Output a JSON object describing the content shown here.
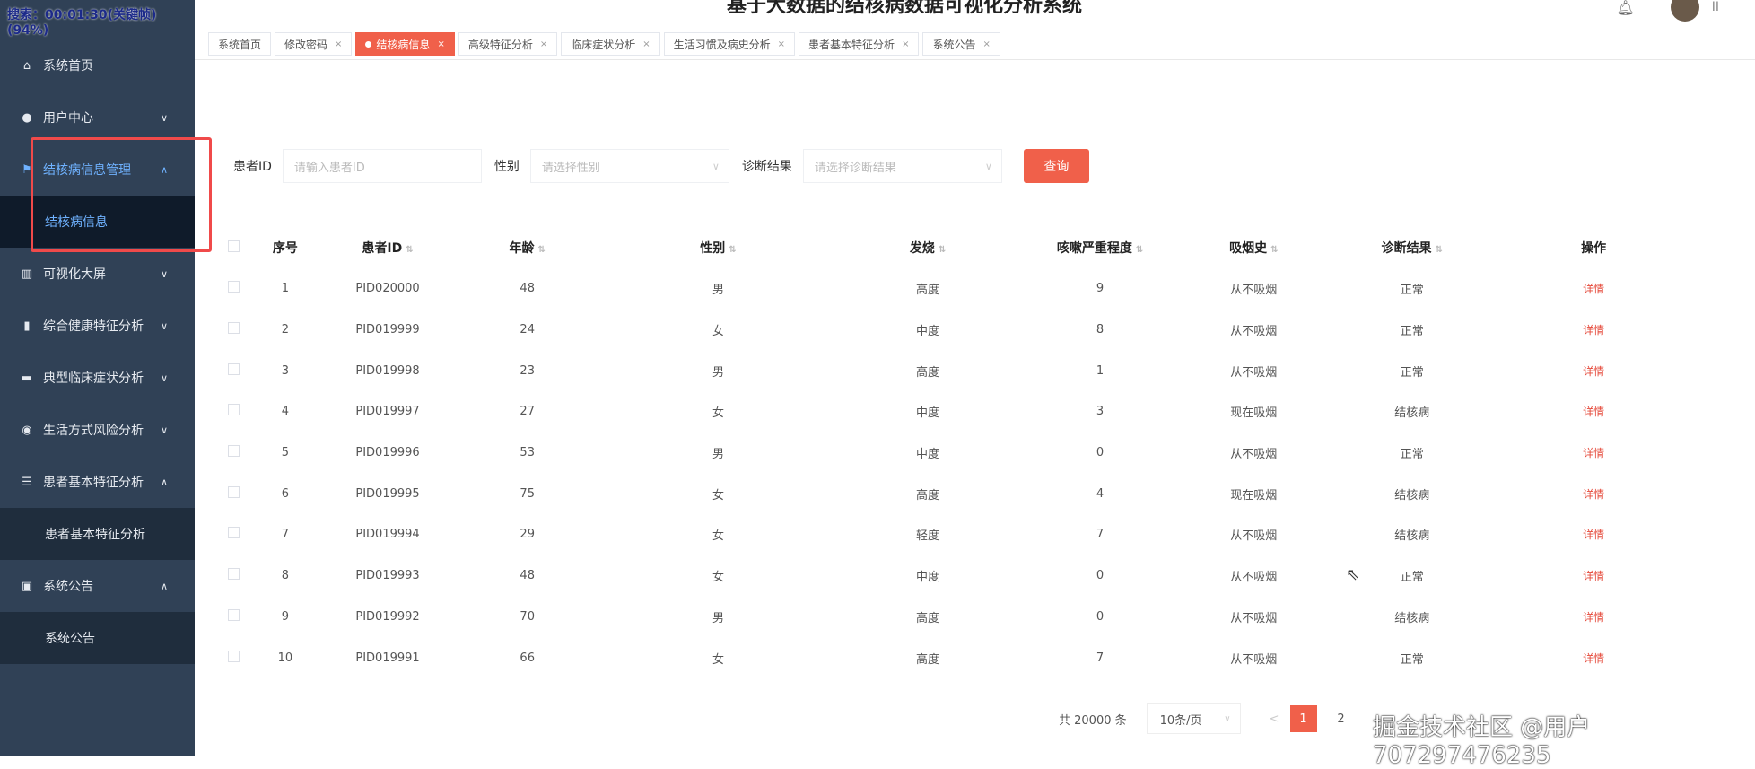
{
  "recording": "搜索：00:01:30(关键帧)(94%)",
  "title": "基于大数据的结核病数据可视化分析系统",
  "user_initial": "II",
  "sidebar": {
    "items": [
      {
        "label": "系统首页",
        "icon": "home-icon"
      },
      {
        "label": "用户中心",
        "icon": "user-icon",
        "chev": "∨"
      },
      {
        "label": "结核病信息管理",
        "icon": "flag-icon",
        "chev": "∧",
        "active": true,
        "sub": [
          "结核病信息"
        ]
      },
      {
        "label": "可视化大屏",
        "icon": "chart-icon",
        "chev": "∨"
      },
      {
        "label": "综合健康特征分析",
        "icon": "bars-icon",
        "chev": "∨"
      },
      {
        "label": "典型临床症状分析",
        "icon": "message-icon",
        "chev": "∨"
      },
      {
        "label": "生活方式风险分析",
        "icon": "bulb-icon",
        "chev": "∨"
      },
      {
        "label": "患者基本特征分析",
        "icon": "list-icon",
        "chev": "∧",
        "sub": [
          "患者基本特征分析"
        ]
      },
      {
        "label": "系统公告",
        "icon": "clipboard-icon",
        "chev": "∧",
        "sub": [
          "系统公告"
        ]
      }
    ]
  },
  "tabs": [
    {
      "label": "系统首页"
    },
    {
      "label": "修改密码",
      "x": "×"
    },
    {
      "label": "结核病信息",
      "x": "×",
      "active": true
    },
    {
      "label": "高级特征分析",
      "x": "×"
    },
    {
      "label": "临床症状分析",
      "x": "×"
    },
    {
      "label": "生活习惯及病史分析",
      "x": "×"
    },
    {
      "label": "患者基本特征分析",
      "x": "×"
    },
    {
      "label": "系统公告",
      "x": "×"
    }
  ],
  "search": {
    "patient_label": "患者ID",
    "patient_placeholder": "请输入患者ID",
    "gender_label": "性别",
    "gender_placeholder": "请选择性别",
    "diag_label": "诊断结果",
    "diag_placeholder": "请选择诊断结果",
    "button": "查询"
  },
  "table": {
    "headers": [
      "序号",
      "患者ID",
      "年龄",
      "性别",
      "发烧",
      "咳嗽严重程度",
      "吸烟史",
      "诊断结果",
      "操作"
    ],
    "rows": [
      [
        "1",
        "PID020000",
        "48",
        "男",
        "高度",
        "9",
        "从不吸烟",
        "正常",
        "详情"
      ],
      [
        "2",
        "PID019999",
        "24",
        "女",
        "中度",
        "8",
        "从不吸烟",
        "正常",
        "详情"
      ],
      [
        "3",
        "PID019998",
        "23",
        "男",
        "高度",
        "1",
        "从不吸烟",
        "正常",
        "详情"
      ],
      [
        "4",
        "PID019997",
        "27",
        "女",
        "中度",
        "3",
        "现在吸烟",
        "结核病",
        "详情"
      ],
      [
        "5",
        "PID019996",
        "53",
        "男",
        "中度",
        "0",
        "从不吸烟",
        "正常",
        "详情"
      ],
      [
        "6",
        "PID019995",
        "75",
        "女",
        "高度",
        "4",
        "现在吸烟",
        "结核病",
        "详情"
      ],
      [
        "7",
        "PID019994",
        "29",
        "女",
        "轻度",
        "7",
        "从不吸烟",
        "结核病",
        "详情"
      ],
      [
        "8",
        "PID019993",
        "48",
        "女",
        "中度",
        "0",
        "从不吸烟",
        "正常",
        "详情"
      ],
      [
        "9",
        "PID019992",
        "70",
        "男",
        "高度",
        "0",
        "从不吸烟",
        "结核病",
        "详情"
      ],
      [
        "10",
        "PID019991",
        "66",
        "女",
        "高度",
        "7",
        "从不吸烟",
        "正常",
        "详情"
      ]
    ]
  },
  "pager": {
    "total": "共 20000 条",
    "size": "10条/页",
    "prev": "<",
    "pages": [
      "1",
      "2"
    ],
    "current": "1"
  },
  "watermark": "掘金技术社区 @用户707297476235"
}
